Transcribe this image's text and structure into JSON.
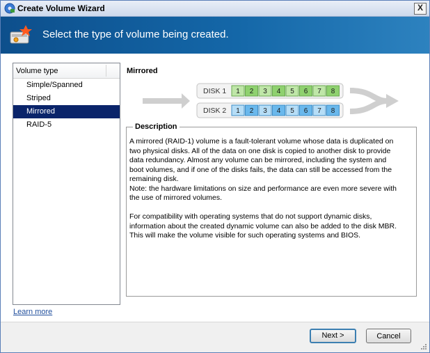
{
  "window": {
    "title": "Create Volume Wizard",
    "close_glyph": "X"
  },
  "header": {
    "text": "Select the type of volume being created.",
    "icon": "wizard-volume-icon"
  },
  "list": {
    "header": "Volume type",
    "items": [
      "Simple/Spanned",
      "Striped",
      "Mirrored",
      "RAID-5"
    ],
    "selected": "Mirrored"
  },
  "option": {
    "title": "Mirrored"
  },
  "diagram": {
    "disks": [
      {
        "label": "DISK 1",
        "blocks": [
          "1",
          "2",
          "3",
          "4",
          "5",
          "6",
          "7",
          "8"
        ],
        "color": "#8fd16f"
      },
      {
        "label": "DISK 2",
        "blocks": [
          "1",
          "2",
          "3",
          "4",
          "5",
          "6",
          "7",
          "8"
        ],
        "color": "#6ab8ec"
      }
    ]
  },
  "description": {
    "legend": "Description",
    "text": "A mirrored (RAID-1) volume is a fault-tolerant volume whose data is duplicated on\ntwo physical disks. All of the data on one disk is copied to another disk to provide\ndata redundancy. Almost any volume can be mirrored, including the system and\nboot volumes, and if one of the disks fails, the data can still be accessed from the\nremaining disk.\nNote: the hardware limitations on size and performance are even more severe with\nthe use of mirrored volumes.\n\nFor compatibility with operating systems that do not support dynamic disks,\ninformation about the created dynamic volume can also be added to the disk MBR.\nThis will make the volume visible for such operating systems and BIOS."
  },
  "footer": {
    "learn_more": "Learn more",
    "next": "Next >",
    "cancel": "Cancel"
  },
  "colors": {
    "header_start": "#0d4f8c",
    "header_end": "#2d82bf",
    "selection": "#0a246a",
    "link": "#1f4e9c"
  }
}
